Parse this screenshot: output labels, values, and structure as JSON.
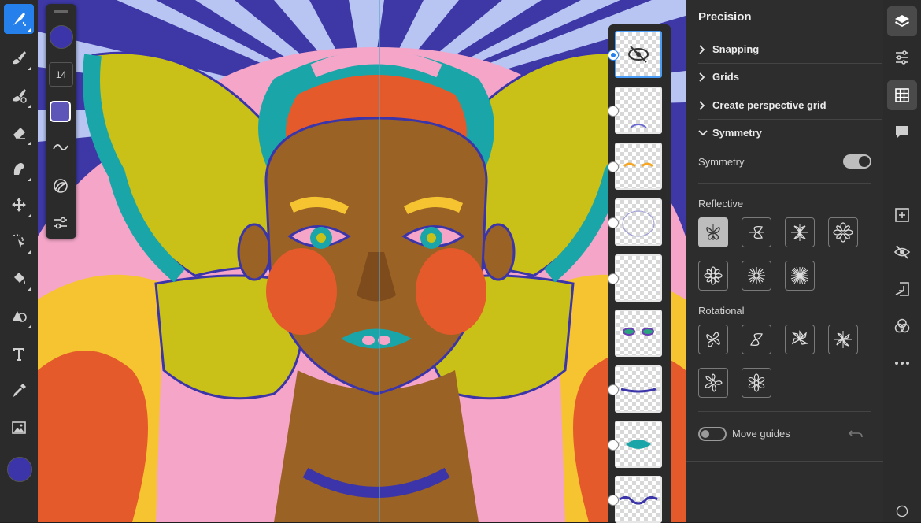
{
  "toolbar": {
    "tools": [
      "pixel-brush",
      "vector-brush",
      "mixer-brush",
      "eraser",
      "liquify",
      "transform",
      "selection",
      "fill",
      "shapes",
      "text",
      "eyedropper",
      "image"
    ],
    "active_tool": "pixel-brush",
    "current_color": "#3b35a9"
  },
  "brush_settings": {
    "color": "#3b35a9",
    "size": "14",
    "opacity_color": "#5d55b8"
  },
  "layers": {
    "count": 9,
    "selected_index": 0
  },
  "precision_panel": {
    "title": "Precision",
    "sections": [
      {
        "label": "Snapping",
        "expanded": false
      },
      {
        "label": "Grids",
        "expanded": false
      },
      {
        "label": "Create perspective grid",
        "expanded": false
      },
      {
        "label": "Symmetry",
        "expanded": true
      }
    ],
    "symmetry_toggle_label": "Symmetry",
    "symmetry_enabled": true,
    "reflective_label": "Reflective",
    "reflective_options": [
      "vertical-mirror",
      "horizontal-mirror",
      "quad",
      "hex",
      "octo",
      "dodeca",
      "radial-16"
    ],
    "reflective_selected": 0,
    "rotational_label": "Rotational",
    "rotational_options": [
      "rot-2",
      "rot-2-diag",
      "rot-3",
      "rot-4",
      "rot-5",
      "rot-6"
    ],
    "move_guides_label": "Move guides",
    "move_guides_enabled": false
  },
  "right_rail": {
    "buttons": [
      "layers",
      "properties",
      "precision",
      "comments",
      "add-layer",
      "hide-layer",
      "import",
      "blend",
      "more"
    ],
    "active": [
      "layers",
      "precision"
    ]
  }
}
